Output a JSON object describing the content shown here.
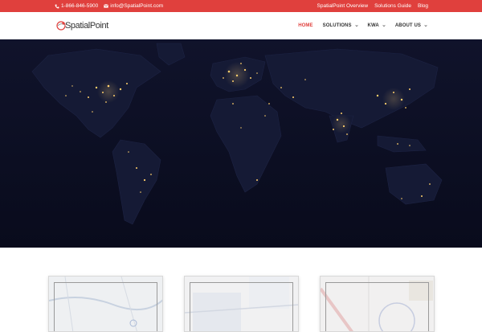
{
  "topbar": {
    "phone": "1-866-846-5900",
    "email": "info@SpatialPoint.com",
    "links": [
      "SpatialPoint Overview",
      "Solutions Guide",
      "Blog"
    ],
    "icons": [
      "phone-icon",
      "envelope-icon"
    ]
  },
  "header": {
    "logo_text": "SpatialPoint",
    "nav": [
      {
        "label": "HOME",
        "active": true,
        "has_dropdown": false
      },
      {
        "label": "SOLUTIONS",
        "active": false,
        "has_dropdown": true
      },
      {
        "label": "KWA",
        "active": false,
        "has_dropdown": true
      },
      {
        "label": "ABOUT US",
        "active": false,
        "has_dropdown": true
      }
    ]
  },
  "colors": {
    "accent": "#e0403d",
    "hero_background": "#0b0e22",
    "text": "#333333"
  },
  "hero": {
    "image": "world-night-lights-map"
  },
  "cards": [
    {
      "image": "map-thumbnail-1"
    },
    {
      "image": "map-thumbnail-2"
    },
    {
      "image": "map-thumbnail-3"
    }
  ]
}
